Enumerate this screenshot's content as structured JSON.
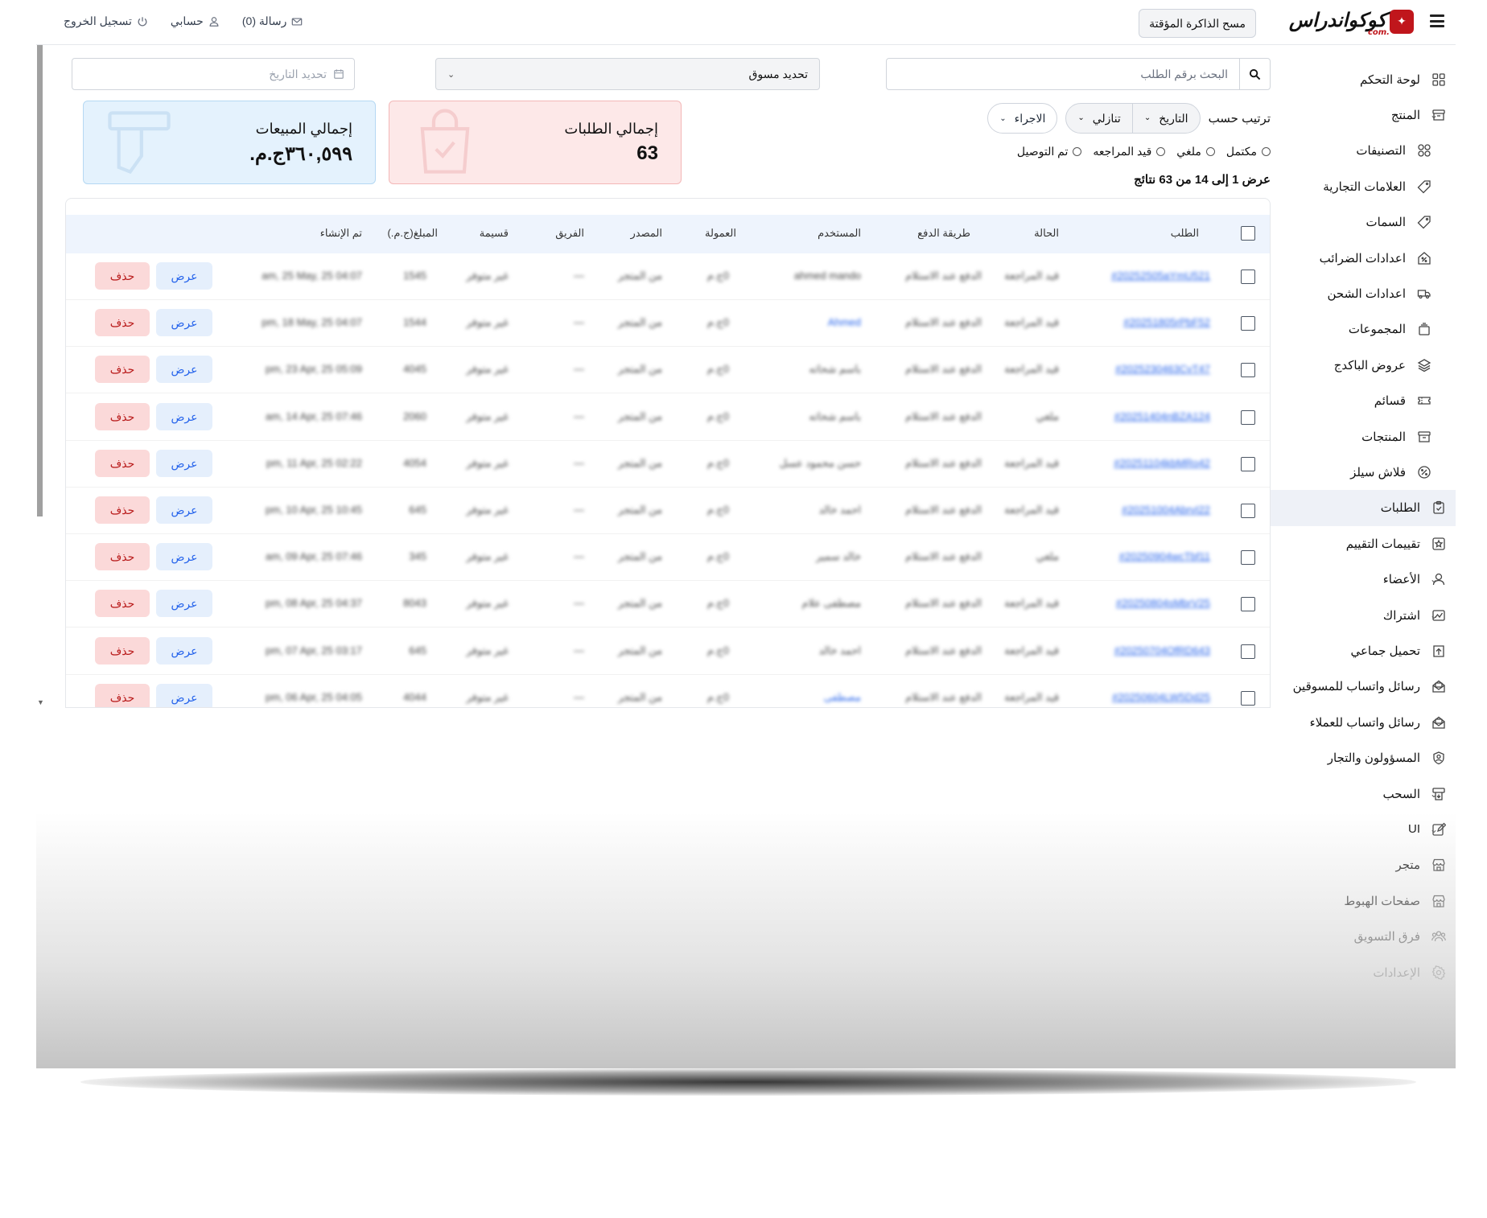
{
  "header": {
    "logo_text": "كوكواندراس",
    "logo_sub": "com.",
    "clear_cache": "مسح الذاكرة المؤقتة",
    "messages": "رسالة (0)",
    "account": "حسابي",
    "logout": "تسجيل الخروج"
  },
  "sidebar": {
    "items": [
      {
        "label": "لوحة التحكم",
        "icon": "dashboard-icon"
      },
      {
        "label": "المنتج",
        "icon": "box-icon",
        "expanded": true
      },
      {
        "label": "التصنيفات",
        "icon": "categories-icon"
      },
      {
        "label": "العلامات التجارية",
        "icon": "tag-icon"
      },
      {
        "label": "السمات",
        "icon": "tag-icon"
      },
      {
        "label": "اعدادات الضرائب",
        "icon": "tax-icon"
      },
      {
        "label": "اعدادات الشحن",
        "icon": "truck-icon"
      },
      {
        "label": "المجموعات",
        "icon": "stack-icon"
      },
      {
        "label": "عروض الباكدج",
        "icon": "layers-icon"
      },
      {
        "label": "قسائم",
        "icon": "ticket-icon"
      },
      {
        "label": "المنتجات",
        "icon": "box-icon"
      },
      {
        "label": "فلاش سيلز",
        "icon": "percent-icon"
      },
      {
        "label": "الطلبات",
        "icon": "clipboard-icon",
        "active": true
      },
      {
        "label": "تقييمات التقييم",
        "icon": "star-icon"
      },
      {
        "label": "الأعضاء",
        "icon": "user-icon"
      },
      {
        "label": "اشتراك",
        "icon": "subscription-icon"
      },
      {
        "label": "تحميل جماعي",
        "icon": "upload-icon"
      },
      {
        "label": "رسائل واتساب للمسوقين",
        "icon": "mail-open-icon"
      },
      {
        "label": "رسائل واتساب للعملاء",
        "icon": "mail-open-icon"
      },
      {
        "label": "المسؤولون والتجار",
        "icon": "admin-icon"
      },
      {
        "label": "السحب",
        "icon": "withdraw-icon"
      },
      {
        "label": "UI",
        "icon": "edit-icon"
      },
      {
        "label": "متجر",
        "icon": "store-icon"
      },
      {
        "label": "صفحات الهبوط",
        "icon": "store-icon"
      },
      {
        "label": "فرق التسويق",
        "icon": "team-icon"
      },
      {
        "label": "الإعدادات",
        "icon": "gear-icon"
      }
    ]
  },
  "filters": {
    "search_placeholder": "البحث برقم الطلب",
    "marketer_select": "تحديد مسوق",
    "date_placeholder": "تحديد التاريخ",
    "sort_label": "ترتيب حسب",
    "sort_field": "التاريخ",
    "sort_order": "تنازلي",
    "actions": "الاجراء",
    "status_options": [
      "مكتمل",
      "ملغي",
      "قيد المراجعه",
      "تم التوصيل"
    ],
    "results": "عرض 1 إلى 14 من 63 نتائج"
  },
  "stats": {
    "orders_title": "إجمالي الطلبات",
    "orders_value": "63",
    "sales_title": "إجمالي المبيعات",
    "sales_value": "٣٦٠,٥٩٩ج.م."
  },
  "table": {
    "headers": [
      "الطلب",
      "الحالة",
      "طريقة الدفع",
      "المستخدم",
      "العمولة",
      "المصدر",
      "الفريق",
      "قسيمة",
      "المبلغ(ج.م.)",
      "تم الإنشاء"
    ],
    "view_label": "عرض",
    "delete_label": "حذف",
    "rows": [
      {
        "order": "#20252505aYmU521",
        "status": "قيد المراجعة",
        "payment": "الدفع عند الاستلام",
        "user": "ahmed mando",
        "commission": "0ج.م",
        "source": "من المتجر",
        "team": "—",
        "coupon": "غير متوفر",
        "amount": "1545",
        "created": "am, 25 May, 25 04:07"
      },
      {
        "order": "#20251805rPbF52",
        "status": "قيد المراجعة",
        "payment": "الدفع عند الاستلام",
        "user": "Ahmed",
        "commission": "0ج.م",
        "source": "من المتجر",
        "team": "—",
        "coupon": "غير متوفر",
        "amount": "1544",
        "created": "pm, 18 May, 25 04:07"
      },
      {
        "order": "#2025230463CvT47",
        "status": "قيد المراجعة",
        "payment": "الدفع عند الاستلام",
        "user": "باسم شحاته",
        "commission": "0ج.م",
        "source": "من المتجر",
        "team": "—",
        "coupon": "غير متوفر",
        "amount": "4045",
        "created": "pm, 23 Apr, 25 05:09"
      },
      {
        "order": "#20251404nBZA124",
        "status": "ملغي",
        "payment": "الدفع عند الاستلام",
        "user": "باسم شحاته",
        "commission": "0ج.م",
        "source": "من المتجر",
        "team": "—",
        "coupon": "غير متوفر",
        "amount": "2060",
        "created": "am, 14 Apr, 25 07:46"
      },
      {
        "order": "#20251104kbMRo42",
        "status": "قيد المراجعة",
        "payment": "الدفع عند الاستلام",
        "user": "حسن محمود عسل",
        "commission": "0ج.م",
        "source": "من المتجر",
        "team": "—",
        "coupon": "غير متوفر",
        "amount": "4054",
        "created": "pm, 11 Apr, 25 02:22"
      },
      {
        "order": "#20251004AbrvI22",
        "status": "قيد المراجعة",
        "payment": "الدفع عند الاستلام",
        "user": "احمد خالد",
        "commission": "0ج.م",
        "source": "من المتجر",
        "team": "—",
        "coupon": "غير متوفر",
        "amount": "645",
        "created": "pm, 10 Apr, 25 10:45"
      },
      {
        "order": "#20250904wcTbf11",
        "status": "ملغي",
        "payment": "الدفع عند الاستلام",
        "user": "خالد سمير",
        "commission": "0ج.م",
        "source": "من المتجر",
        "team": "—",
        "coupon": "غير متوفر",
        "amount": "345",
        "created": "am, 09 Apr, 25 07:46"
      },
      {
        "order": "#20250804sMbrV25",
        "status": "قيد المراجعة",
        "payment": "الدفع عند الاستلام",
        "user": "مصطفى علام",
        "commission": "0ج.م",
        "source": "من المتجر",
        "team": "—",
        "coupon": "غير متوفر",
        "amount": "8043",
        "created": "pm, 08 Apr, 25 04:37"
      },
      {
        "order": "#20250704OfRD643",
        "status": "قيد المراجعة",
        "payment": "الدفع عند الاستلام",
        "user": "احمد خالد",
        "commission": "0ج.م",
        "source": "من المتجر",
        "team": "—",
        "coupon": "غير متوفر",
        "amount": "645",
        "created": "pm, 07 Apr, 25 03:17"
      },
      {
        "order": "#20250604LW5Dd25",
        "status": "قيد المراجعة",
        "payment": "الدفع عند الاستلام",
        "user": "مصطفى",
        "commission": "0ج.م",
        "source": "من المتجر",
        "team": "—",
        "coupon": "غير متوفر",
        "amount": "4044",
        "created": "pm, 06 Apr, 25 04:05"
      }
    ]
  },
  "colors": {
    "accent": "#2563eb",
    "danger": "#b91c1c",
    "orders_card": "#fde8e8",
    "sales_card": "#e4f2fd"
  }
}
